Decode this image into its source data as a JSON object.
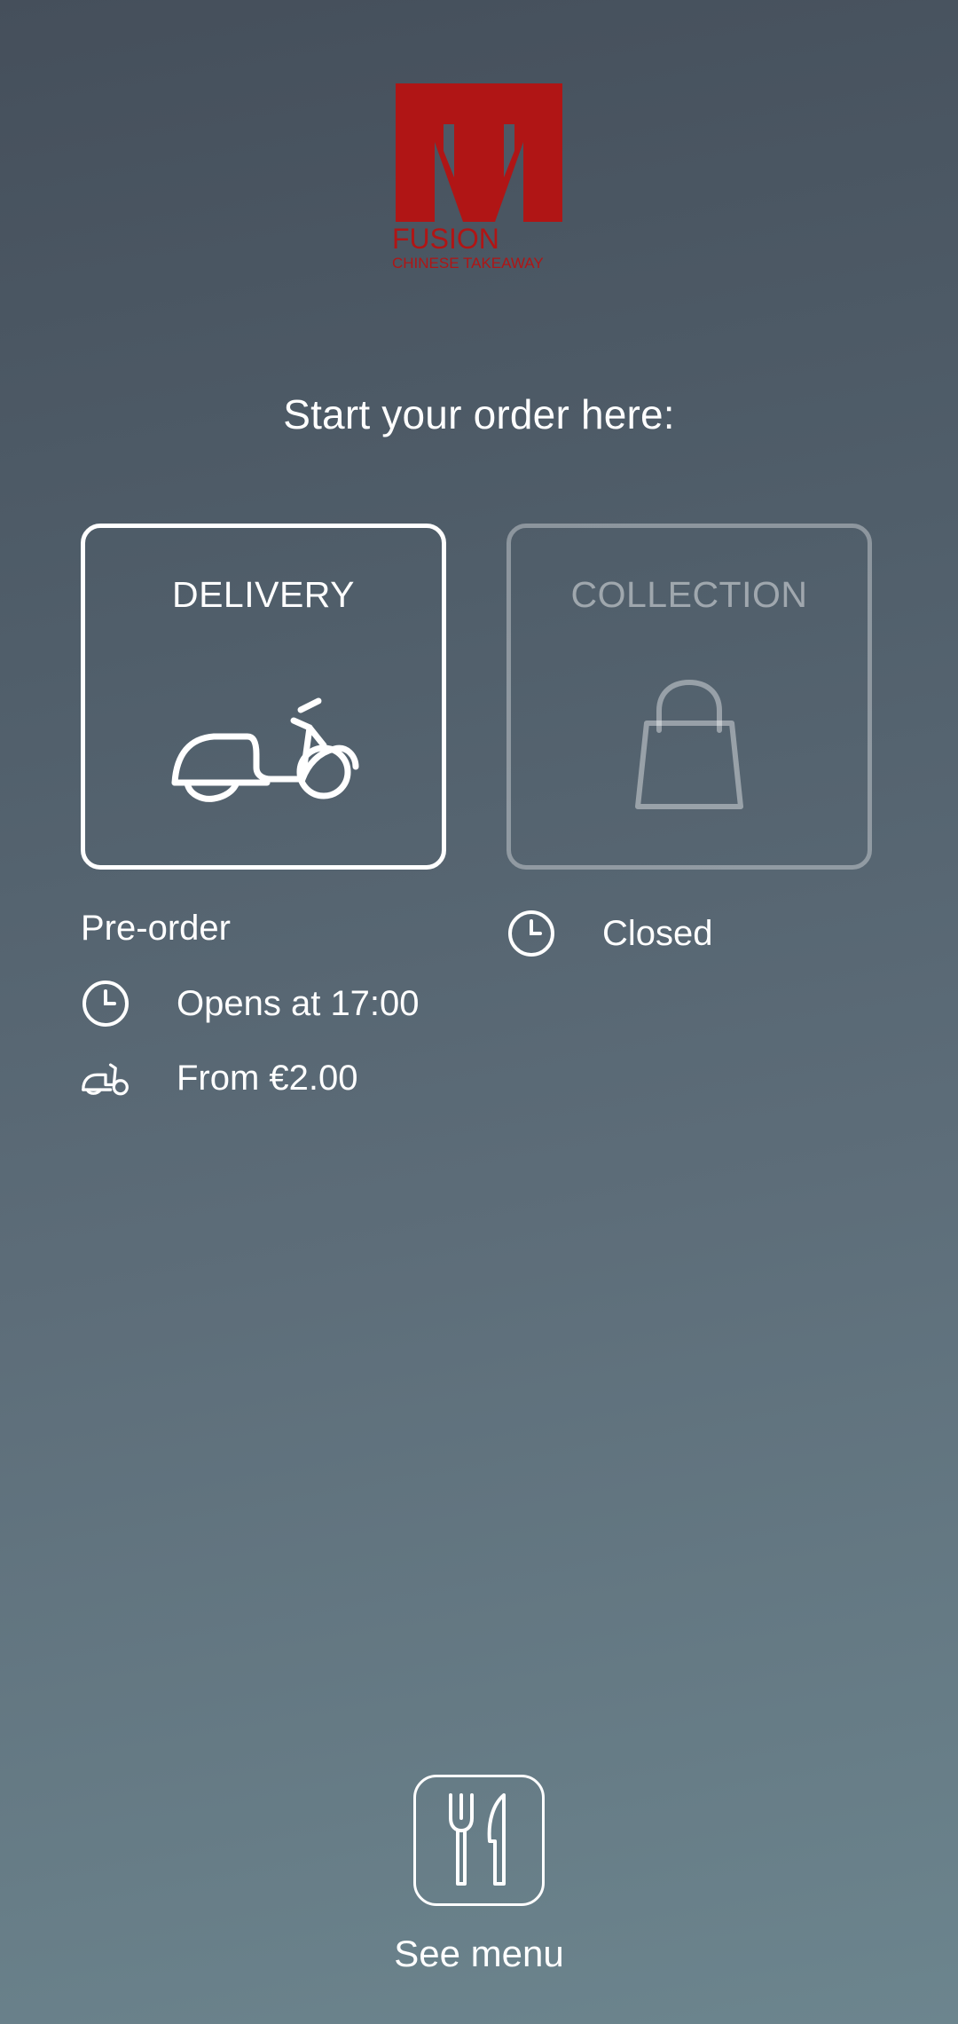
{
  "logo": {
    "letter": "M",
    "brand": "FUSION",
    "tagline": "CHINESE TAKEAWAY",
    "color": "#b01515"
  },
  "headline": "Start your order here:",
  "delivery": {
    "label": "DELIVERY",
    "icon": "scooter-icon",
    "status": "Pre-order",
    "opens_text": "Opens at 17:00",
    "fee_text": "From €2.00"
  },
  "collection": {
    "label": "COLLECTION",
    "icon": "shopping-bag-icon",
    "status_text": "Closed"
  },
  "menu": {
    "label": "See menu",
    "icon": "cutlery-icon"
  },
  "colors": {
    "text": "#ffffff",
    "disabled": "rgba(255,255,255,0.45)",
    "brand_red": "#b01515"
  }
}
